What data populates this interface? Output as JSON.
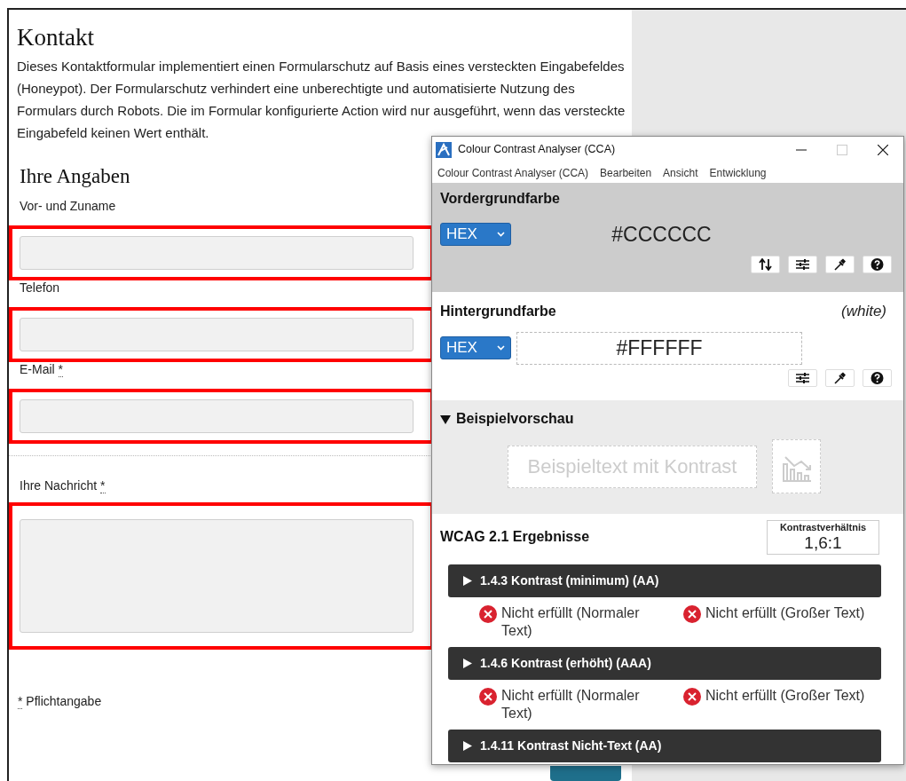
{
  "page": {
    "title": "Kontakt",
    "intro": "Dieses Kontaktformular implementiert einen Formularschutz auf Basis eines versteckten Eingabefeldes (Honeypot). Der Formularschutz verhindert eine unberechtigte und automatisierte Nutzung des Formulars durch Robots. Die im Formular konfigurierte Action wird nur ausgeführt, wenn das versteckte Eingabefeld keinen Wert enthält.",
    "section_title": "Ihre Angaben",
    "fields": [
      {
        "label": "Vor- und Zuname",
        "kind": "input",
        "highlighted": true
      },
      {
        "label": "Telefon",
        "kind": "input",
        "highlighted": true
      },
      {
        "label": "E-Mail",
        "required_mark": "*",
        "kind": "input",
        "highlighted": true
      },
      {
        "label": "Ihre Nachricht",
        "required_mark": "*",
        "kind": "textarea",
        "highlighted": true,
        "separator_before": true
      }
    ],
    "required_note": {
      "mark": "*",
      "text": "Pflichtangabe"
    }
  },
  "cca": {
    "title": "Colour Contrast Analyser (CCA)",
    "menu": [
      "Colour Contrast Analyser (CCA)",
      "Bearbeiten",
      "Ansicht",
      "Entwicklung"
    ],
    "foreground": {
      "heading": "Vordergrundfarbe",
      "format": "HEX",
      "value": "#CCCCCC"
    },
    "background": {
      "heading": "Hintergrundfarbe",
      "color_name": "(white)",
      "format": "HEX",
      "value": "#FFFFFF"
    },
    "preview": {
      "heading": "Beispielvorschau",
      "expanded": true,
      "sample": "Beispieltext mit Kontrast"
    },
    "results": {
      "heading": "WCAG 2.1 Ergebnisse",
      "ratio_label": "Kontrastverhältnis",
      "ratio": "1,6:1",
      "criteria": [
        {
          "title": "1.4.3 Kontrast (minimum) (AA)",
          "expanded": false,
          "outcomes": [
            {
              "text": "Nicht erfüllt (Normaler Text)",
              "passed": false
            },
            {
              "text": "Nicht erfüllt (Großer Text)",
              "passed": false
            }
          ]
        },
        {
          "title": "1.4.6 Kontrast (erhöht) (AAA)",
          "expanded": false,
          "outcomes": [
            {
              "text": "Nicht erfüllt (Normaler Text)",
              "passed": false
            },
            {
              "text": "Nicht erfüllt (Großer Text)",
              "passed": false
            }
          ]
        },
        {
          "title": "1.4.11 Kontrast Nicht-Text (AA)",
          "expanded": false
        }
      ]
    }
  }
}
